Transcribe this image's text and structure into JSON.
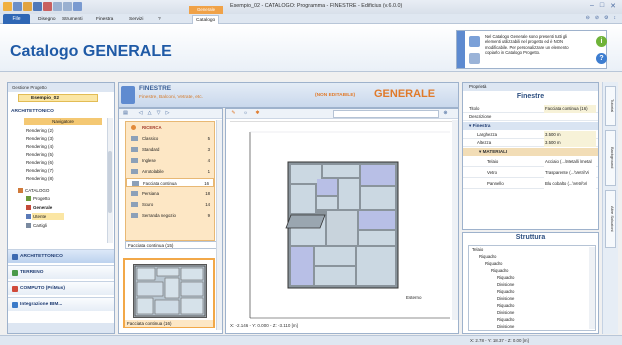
{
  "window": {
    "title": "Esempio_02 - CATALOGO: Programma - FINESTRE - Edificius (v.6.0.0)",
    "context_tab": "Generale",
    "controls": [
      "–",
      "□",
      "✕"
    ]
  },
  "ribbon": {
    "file_label": "File",
    "tabs": [
      "Disegno",
      "Strumenti",
      "Finestra",
      "Servizi",
      "?",
      "Catalogo"
    ],
    "right_icons": [
      "⊖",
      "⊘",
      "⚙",
      "↕"
    ],
    "catalog_title": "Catalogo GENERALE",
    "info_text": "Nel Catalogo Generale sono presenti tutti gli elementi utilizzabili nel progetto ed è NON modificabile. Per personalizzare un elemento copiarlo in Catalogo Progetto.",
    "info_btn_green": "i",
    "info_btn_blue": "?"
  },
  "left_panel": {
    "header": "Gestione Progetto",
    "project": "Esempio_02",
    "section_title": "ARCHITETTONICO",
    "navigator": "Navigatore",
    "tree": [
      "Rendering (2)",
      "Rendering (3)",
      "Rendering (4)",
      "Rendering (5)",
      "Rendering (6)",
      "Rendering (7)",
      "Rendering (8)"
    ],
    "catalog_node": "CATALOGO",
    "catalog_children": [
      "Progetto",
      "Generale",
      "Utente",
      "Cartigli"
    ],
    "sections": [
      "ARCHITETTONICO",
      "TERRENO",
      "COMPUTO (PriMus)",
      "Integrazione BIM..."
    ]
  },
  "center_header": {
    "title": "FINESTRE",
    "subtitle": "Finestre, Balconi, Vetrate, etc.",
    "noedit": "(NON EDITABILE)",
    "catalog": "GENERALE"
  },
  "catalog_list": {
    "search": "RICERCA",
    "items": [
      {
        "label": "Classico",
        "count": "5"
      },
      {
        "label": "Standard",
        "count": "3"
      },
      {
        "label": "Inglese",
        "count": "4"
      },
      {
        "label": "Arrotolabile",
        "count": "1"
      },
      {
        "label": "Facciata continua",
        "count": "16"
      },
      {
        "label": "Persiana",
        "count": "18"
      },
      {
        "label": "Scuro",
        "count": "14"
      },
      {
        "label": "Serranda negozio",
        "count": "9"
      }
    ],
    "preview1_label": "Facciata continua (15)",
    "preview2_label": "Facciata continua (16)"
  },
  "viewer": {
    "coords": "X: -2.146 - Y: 0.000 - Z: -3.110 [m]",
    "label": "Esterno"
  },
  "properties": {
    "header": "Proprietà",
    "title": "Finestre",
    "rows": [
      {
        "k": "Titolo",
        "v": "Facciata continua (16)"
      },
      {
        "k": "Descrizione",
        "v": ""
      }
    ],
    "group1": "Finestra",
    "group1_rows": [
      {
        "k": "Larghezza",
        "v": "3.500 m"
      },
      {
        "k": "Altezza",
        "v": "3.500 m"
      }
    ],
    "group2": "MATERIALI",
    "group2_rows": [
      {
        "k": "Telaio",
        "v": "Acciaio  (...\\Metalli \\metal"
      },
      {
        "k": "Vetro",
        "v": "Trasparente  (...\\Vetri\\Vi"
      },
      {
        "k": "Pannello",
        "v": "Blu cobalto  (...\\Vetri\\Vi"
      }
    ]
  },
  "structure": {
    "title": "Struttura",
    "items": [
      "Telaio",
      "Riquadro",
      "Riquadro",
      "Riquadro",
      "Riquadro",
      "Divisione",
      "Riquadro",
      "Divisione",
      "Riquadro",
      "Divisione",
      "Riquadro",
      "Divisione"
    ]
  },
  "vtabs": [
    "Tutorial",
    "Background",
    "Altre Soluzioni"
  ],
  "status": {
    "coords": "X: 2.78 - Y: 18.37 - Z: 0.00 [m]"
  },
  "colors": {
    "accent": "#1f5aa6",
    "orange": "#e07a2a",
    "selected": "#fbe6a4"
  }
}
